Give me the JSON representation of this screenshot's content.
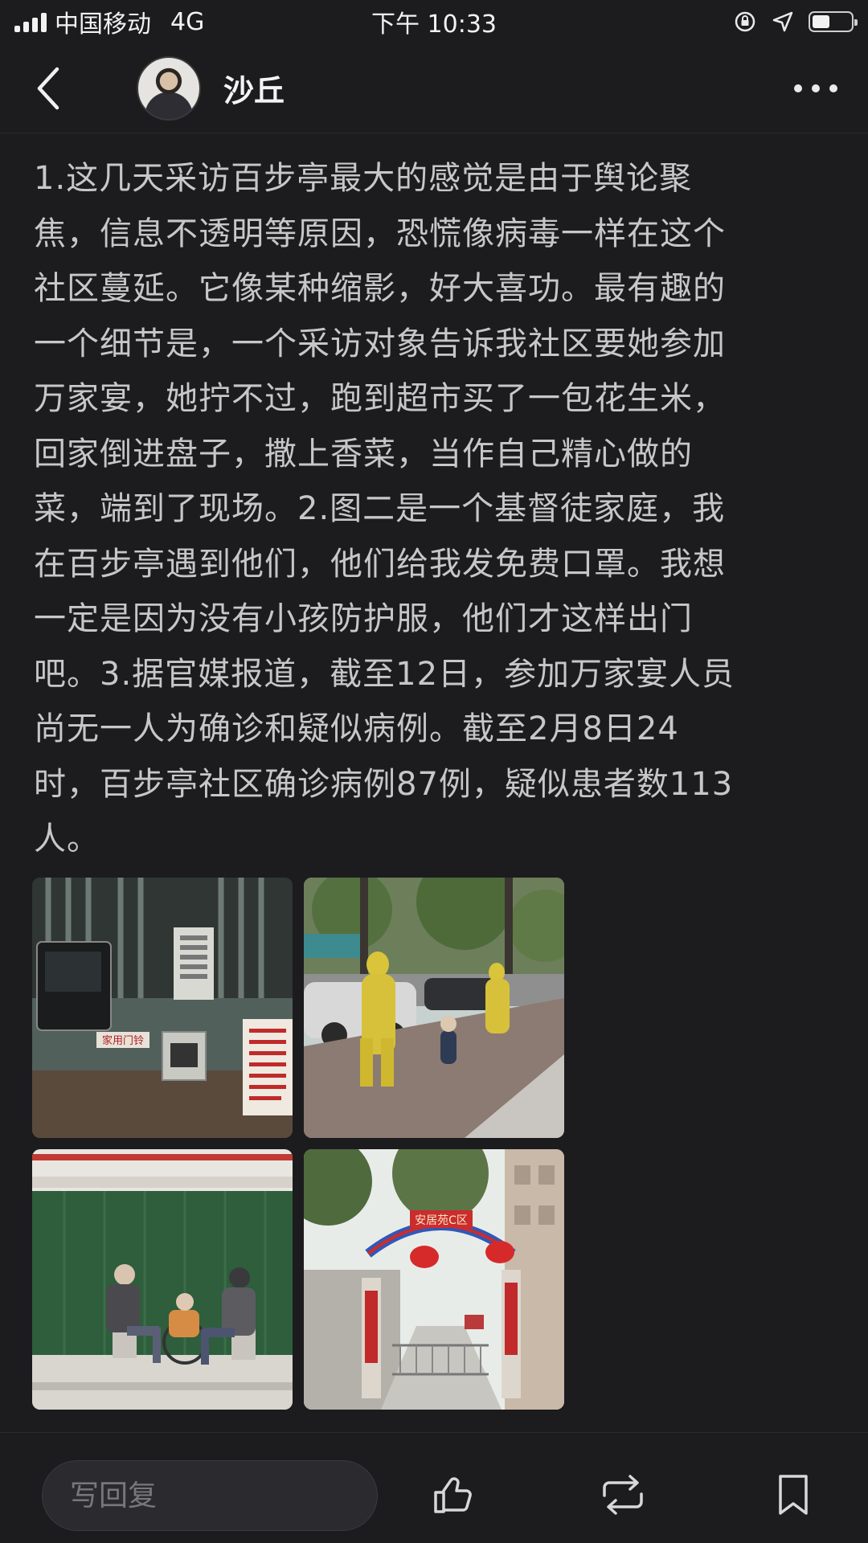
{
  "status_bar": {
    "carrier": "中国移动",
    "network": "4G",
    "time": "下午 10:33",
    "battery_level": 0.45
  },
  "nav": {
    "title": "沙丘"
  },
  "post": {
    "lines": [
      "1.这几天采访百步亭最大的感觉是由于舆论聚",
      "焦，信息不透明等原因，恐慌像病毒一样在这个",
      "社区蔓延。它像某种缩影，好大喜功。最有趣的",
      "一个细节是，一个采访对象告诉我社区要她参加",
      "万家宴，她拧不过，跑到超市买了一包花生米，",
      "回家倒进盘子，撒上香菜，当作自己精心做的",
      "菜，端到了现场。2.图二是一个基督徒家庭，我",
      "在百步亭遇到他们，他们给我发免费口罩。我想",
      "一定是因为没有小孩防护服，他们才这样出门",
      "吧。3.据官媒报道，截至12日，参加万家宴人员",
      "尚无一人为确诊和疑似病例。截至2月8日24",
      "时，百步亭社区确诊病例87例，疑似患者数113",
      "人。"
    ],
    "photos": {
      "photo1_sign": "家用门铃",
      "photo4_arch": "安居苑C区"
    }
  },
  "bottom_bar": {
    "reply_placeholder": "写回复"
  },
  "icons": {
    "back": "chevron-left-icon",
    "more": "more-dots-icon",
    "like": "thumbs-up-icon",
    "repost": "repost-icon",
    "bookmark": "bookmark-icon"
  }
}
